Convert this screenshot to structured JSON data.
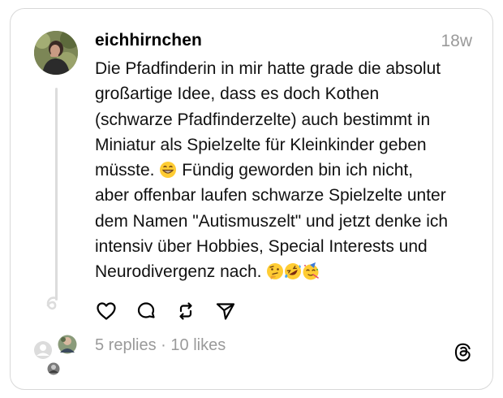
{
  "post": {
    "username": "eichhirnchen",
    "time": "18w",
    "body_lines": [
      "Die Pfadfinderin in mir hatte grade die absolut",
      "großartige Idee, dass es doch Kothen",
      "(schwarze Pfadfinderzelte) auch bestimmt in",
      "Miniatur als Spielzelte für Kleinkinder geben",
      "müsste.",
      "Fündig geworden bin ich nicht,",
      "aber offenbar laufen schwarze Spielzelte unter",
      "dem Namen \"Autismuszelt\" und jetzt denke ich",
      "intensiv über Hobbies, Special Interests und",
      "Neurodivergenz nach."
    ],
    "inline_emoji_after_line5": "grinning-face-emoji",
    "trailing_emojis": [
      "thinking-face-emoji",
      "rolling-laughing-emoji",
      "partying-face-emoji"
    ]
  },
  "actions": {
    "like_icon": "heart-icon",
    "reply_icon": "comment-icon",
    "repost_icon": "repost-icon",
    "share_icon": "send-icon"
  },
  "stats": {
    "replies": "5 replies",
    "separator": " · ",
    "likes": "10 likes"
  },
  "brand": {
    "logo": "threads-logo-icon"
  },
  "colors": {
    "muted": "#9a9a9a",
    "border": "#d8d8d8",
    "thread_line": "#dcdcdc"
  }
}
